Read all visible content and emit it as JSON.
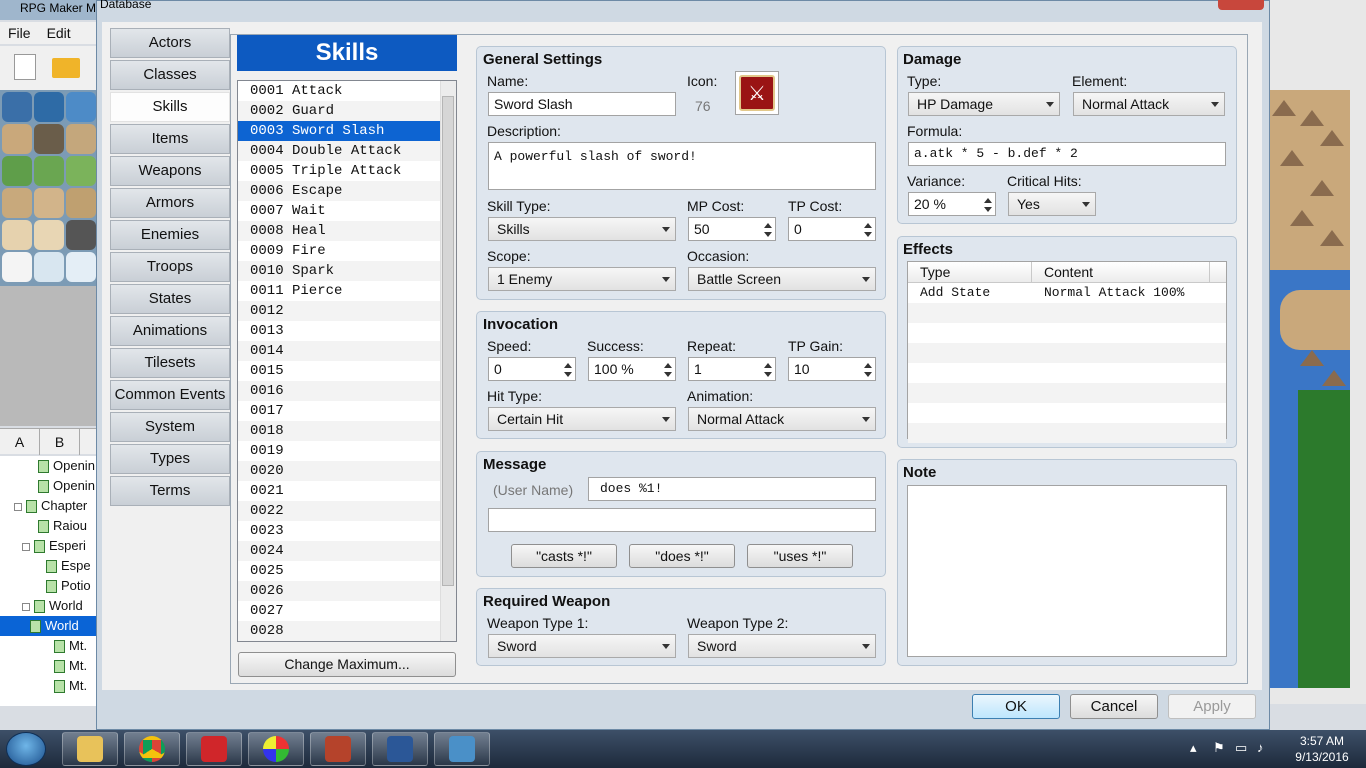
{
  "app": {
    "title": "RPG Maker M",
    "menu": [
      "File",
      "Edit"
    ],
    "map_tabs": [
      "A",
      "B"
    ],
    "map_tree": [
      {
        "label": "Openin"
      },
      {
        "label": "Openin"
      },
      {
        "label": "Chapter"
      },
      {
        "label": "Raiou"
      },
      {
        "label": "Esperi"
      },
      {
        "label": "Espe"
      },
      {
        "label": "Potio"
      },
      {
        "label": "World"
      },
      {
        "label": "World"
      },
      {
        "label": "Mt."
      },
      {
        "label": "Mt."
      },
      {
        "label": "Mt."
      }
    ]
  },
  "dialog": {
    "title": "Database",
    "categories": [
      "Actors",
      "Classes",
      "Skills",
      "Items",
      "Weapons",
      "Armors",
      "Enemies",
      "Troops",
      "States",
      "Animations",
      "Tilesets",
      "Common Events",
      "System",
      "Types",
      "Terms"
    ],
    "selected_category": "Skills",
    "list_header": "Skills",
    "skills": [
      "0001 Attack",
      "0002 Guard",
      "0003 Sword Slash",
      "0004 Double Attack",
      "0005 Triple Attack",
      "0006 Escape",
      "0007 Wait",
      "0008 Heal",
      "0009 Fire",
      "0010 Spark",
      "0011 Pierce",
      "0012",
      "0013",
      "0014",
      "0015",
      "0016",
      "0017",
      "0018",
      "0019",
      "0020",
      "0021",
      "0022",
      "0023",
      "0024",
      "0025",
      "0026",
      "0027",
      "0028"
    ],
    "selected_skill": "0003 Sword Slash",
    "change_maximum": "Change Maximum...",
    "general": {
      "title": "General Settings",
      "name_label": "Name:",
      "name": "Sword Slash",
      "icon_label": "Icon:",
      "icon_index": "76",
      "description_label": "Description:",
      "description": "A powerful slash of sword!",
      "skill_type_label": "Skill Type:",
      "skill_type": "Skills",
      "mp_cost_label": "MP Cost:",
      "mp_cost": "50",
      "tp_cost_label": "TP Cost:",
      "tp_cost": "0",
      "scope_label": "Scope:",
      "scope": "1 Enemy",
      "occasion_label": "Occasion:",
      "occasion": "Battle Screen"
    },
    "invocation": {
      "title": "Invocation",
      "speed_label": "Speed:",
      "speed": "0",
      "success_label": "Success:",
      "success": "100 %",
      "repeat_label": "Repeat:",
      "repeat": "1",
      "tp_gain_label": "TP Gain:",
      "tp_gain": "10",
      "hit_type_label": "Hit Type:",
      "hit_type": "Certain Hit",
      "animation_label": "Animation:",
      "animation": "Normal Attack"
    },
    "message": {
      "title": "Message",
      "user_name": "(User Name)",
      "line1": "does %1!",
      "line2": "",
      "btn_casts": "\"casts *!\"",
      "btn_does": "\"does *!\"",
      "btn_uses": "\"uses *!\""
    },
    "required_weapon": {
      "title": "Required Weapon",
      "type1_label": "Weapon Type 1:",
      "type1": "Sword",
      "type2_label": "Weapon Type 2:",
      "type2": "Sword"
    },
    "damage": {
      "title": "Damage",
      "type_label": "Type:",
      "type": "HP Damage",
      "element_label": "Element:",
      "element": "Normal Attack",
      "formula_label": "Formula:",
      "formula": "a.atk * 5 - b.def * 2",
      "variance_label": "Variance:",
      "variance": "20 %",
      "critical_label": "Critical Hits:",
      "critical": "Yes"
    },
    "effects": {
      "title": "Effects",
      "col_type": "Type",
      "col_content": "Content",
      "rows": [
        {
          "type": "Add State",
          "content": "Normal Attack 100%"
        }
      ]
    },
    "note": {
      "title": "Note",
      "text": ""
    },
    "buttons": {
      "ok": "OK",
      "cancel": "Cancel",
      "apply": "Apply"
    }
  },
  "taskbar": {
    "time": "3:57 AM",
    "date": "9/13/2016",
    "icons": [
      "explorer-icon",
      "chrome-icon",
      "game-controller-icon",
      "color-wheel-icon",
      "rpg-maker-icon",
      "word-icon",
      "photo-viewer-icon"
    ]
  }
}
